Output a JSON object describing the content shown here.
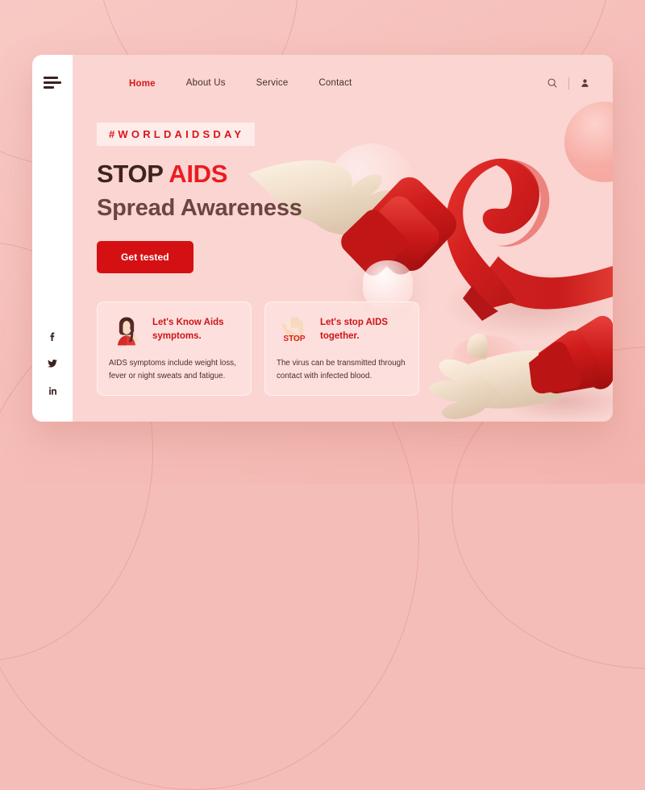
{
  "site": {
    "brand_red": "#d8161a",
    "panel_bg": "#fad5d1",
    "page_bg": "#f5bdb8"
  },
  "nav": {
    "menu_icon": "hamburger-icon",
    "links": [
      {
        "label": "Home",
        "active": true
      },
      {
        "label": "About Us",
        "active": false
      },
      {
        "label": "Service",
        "active": false
      },
      {
        "label": "Contact",
        "active": false
      }
    ],
    "actions": [
      {
        "icon": "search-icon"
      },
      {
        "icon": "user-icon"
      }
    ]
  },
  "social": [
    {
      "name": "facebook-icon",
      "glyph": "f"
    },
    {
      "name": "twitter-icon",
      "glyph": "t"
    },
    {
      "name": "linkedin-icon",
      "glyph": "in"
    }
  ],
  "hero": {
    "tag": "#WORLDAIDSDAY",
    "headline_plain": "STOP ",
    "headline_accent": "AIDS",
    "subheadline": "Spread Awareness",
    "cta_label": "Get tested"
  },
  "cards": [
    {
      "art": "woman-headache-illustration",
      "title": "Let's Know Aids symptoms.",
      "body": "AIDS symptoms include weight loss, fever or night sweats and fatigue."
    },
    {
      "art": "stop-hand-illustration",
      "title": "Let's stop AIDS together.",
      "body": "The virus can be transmitted through contact with infected blood."
    }
  ],
  "artwork": {
    "ribbon": "aids-awareness-ribbon",
    "hand_top": "3d-hand-reaching-right",
    "hand_bottom": "3d-hand-reaching-left",
    "stop_word": "STOP"
  }
}
